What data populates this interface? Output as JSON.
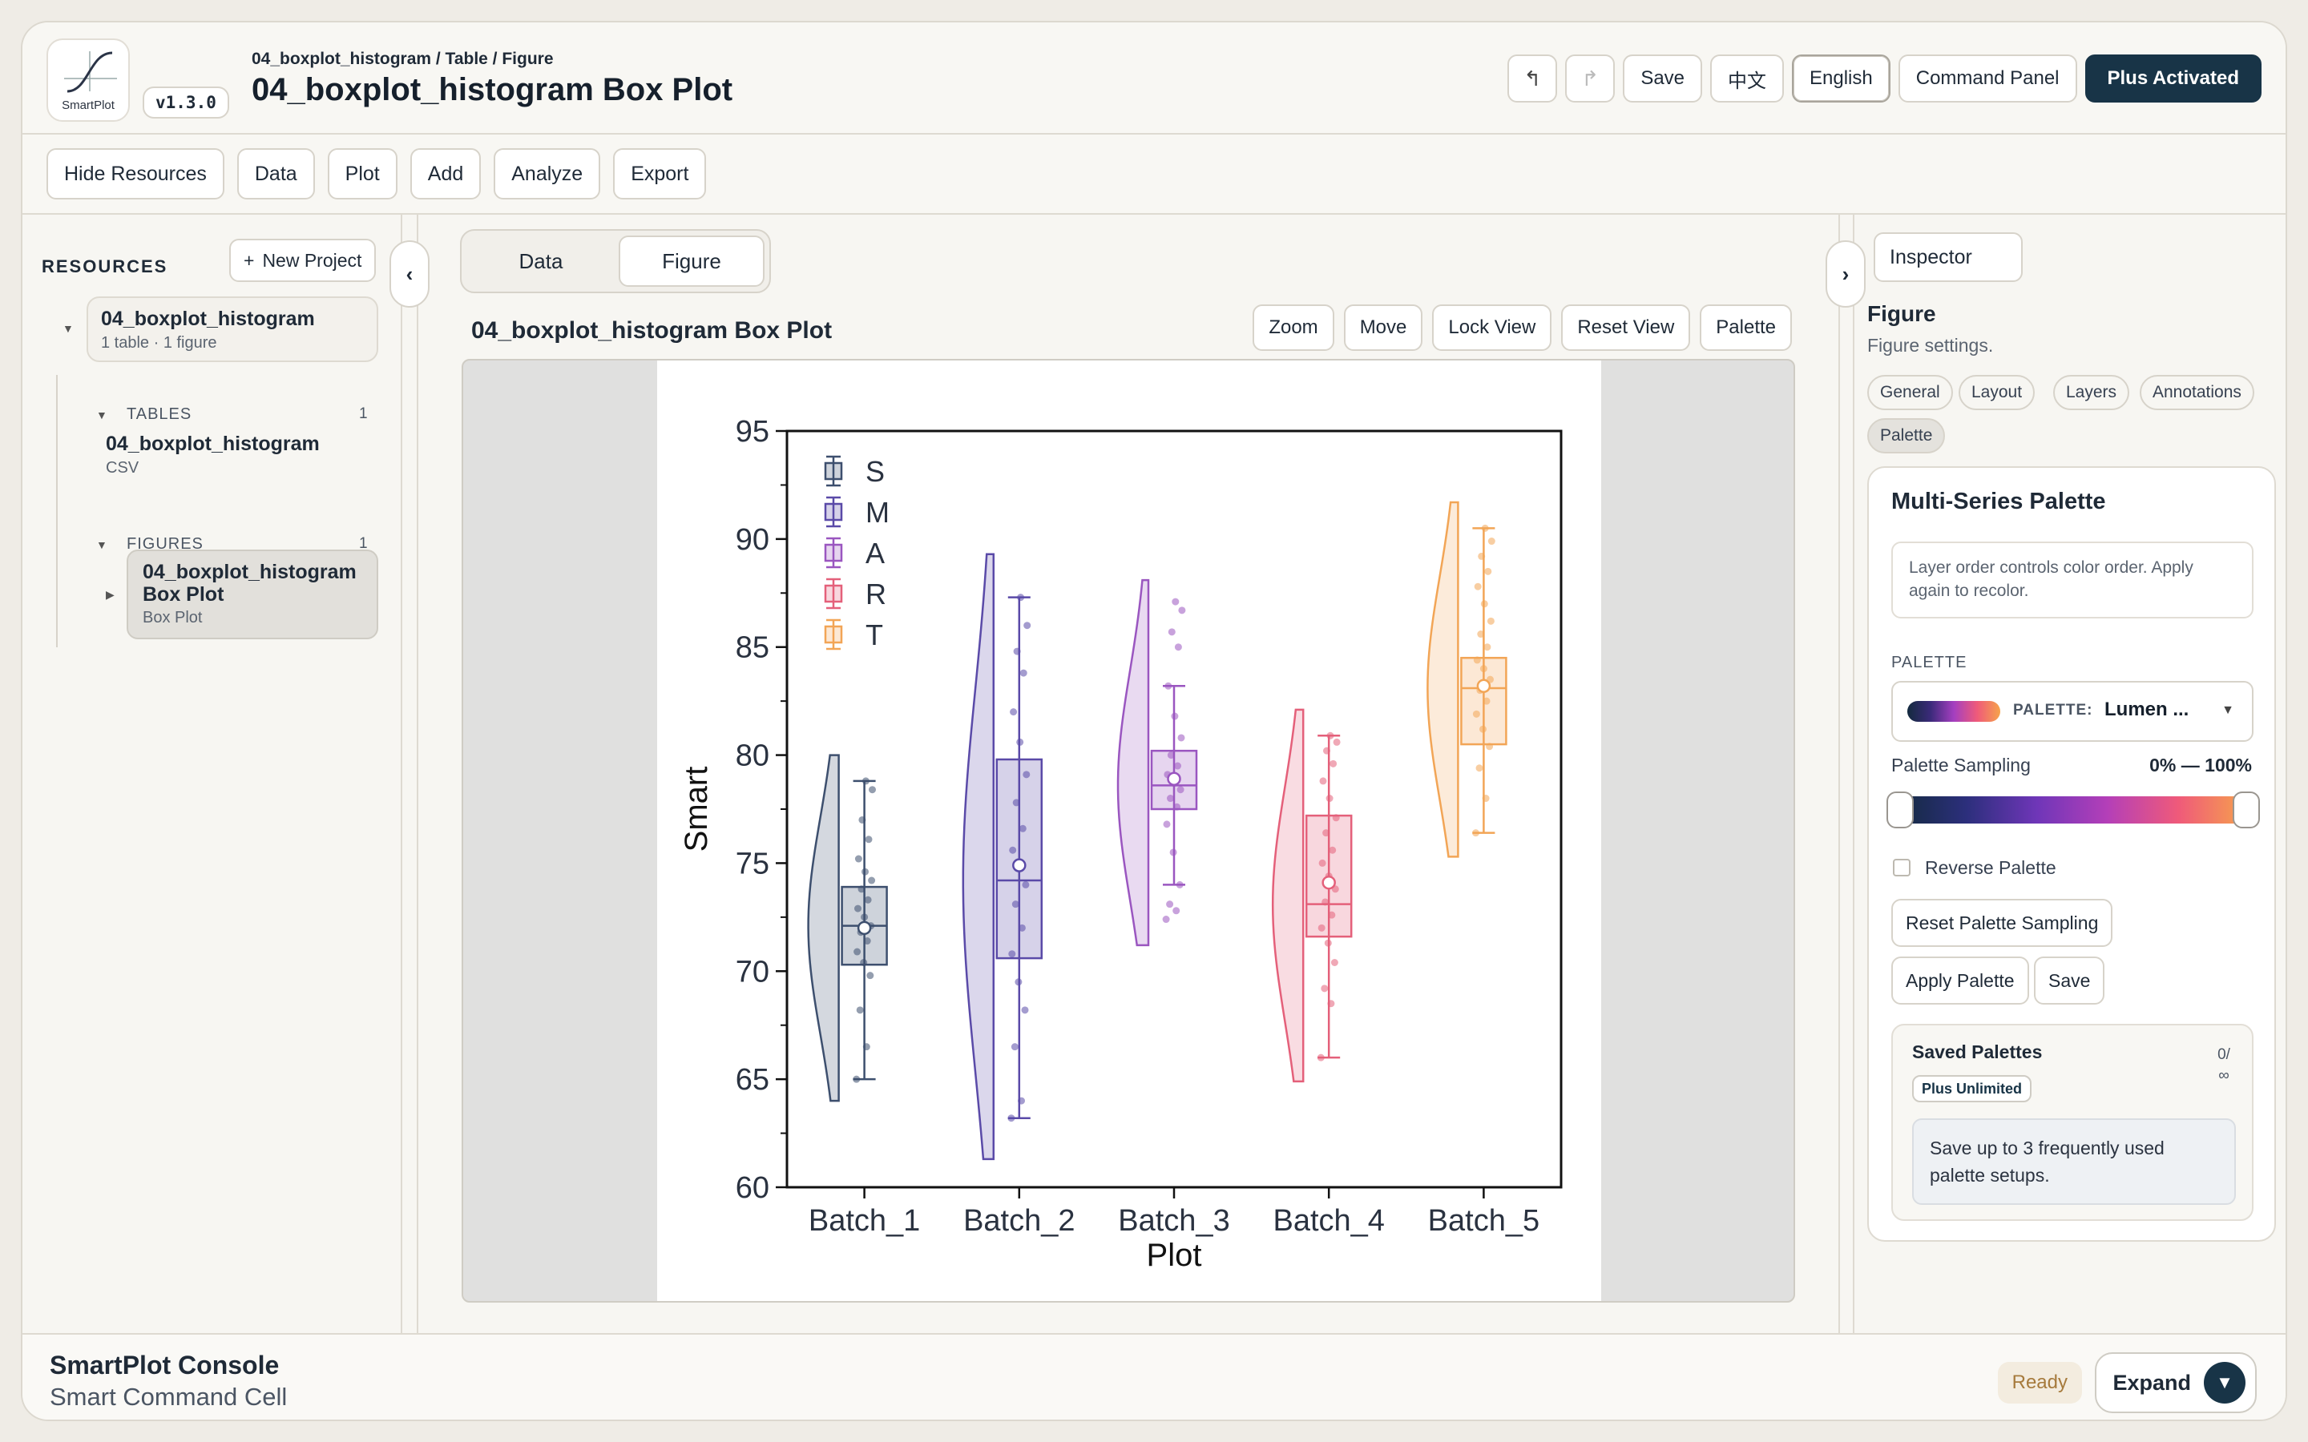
{
  "app": {
    "logo_text": "SmartPlot",
    "version": "v1.3.0",
    "breadcrumb": "04_boxplot_histogram / Table / Figure",
    "title": "04_boxplot_histogram Box Plot"
  },
  "header": {
    "undo_icon": "undo-icon",
    "redo_icon": "redo-icon",
    "save": "Save",
    "lang_zh": "中文",
    "lang_en": "English",
    "command_panel": "Command Panel",
    "plus": "Plus Activated"
  },
  "toolbar": [
    "Hide Resources",
    "Data",
    "Plot",
    "Add",
    "Analyze",
    "Export"
  ],
  "resources": {
    "heading": "RESOURCES",
    "new_project": "New Project",
    "project_name": "04_boxplot_histogram",
    "project_meta": "1 table · 1 figure",
    "tables_label": "TABLES",
    "tables_count": "1",
    "table_name": "04_boxplot_histogram",
    "table_type": "CSV",
    "figures_label": "FIGURES",
    "figures_count": "1",
    "figure_name": "04_boxplot_histogram Box Plot",
    "figure_type": "Box Plot"
  },
  "center": {
    "tab_data": "Data",
    "tab_figure": "Figure",
    "figure_title": "04_boxplot_histogram Box Plot",
    "buttons": [
      "Zoom",
      "Move",
      "Lock View",
      "Reset View",
      "Palette"
    ]
  },
  "inspector": {
    "button": "Inspector",
    "title": "Figure",
    "subtitle": "Figure settings.",
    "tabs": [
      "General",
      "Layout",
      "Layers",
      "Annotations",
      "Palette"
    ],
    "card_title": "Multi-Series Palette",
    "note": "Layer order controls color order. Apply again to recolor.",
    "palette_label": "PALETTE",
    "select_label": "PALETTE:",
    "select_value": "Lumen ...",
    "sampling_label": "Palette Sampling",
    "sampling_value": "0% — 100%",
    "sampling_range": [
      0,
      100
    ],
    "reverse": "Reverse Palette",
    "reset_btn": "Reset Palette Sampling",
    "apply_btn": "Apply Palette",
    "save_btn": "Save",
    "saved_title": "Saved Palettes",
    "saved_count": "0/ ∞",
    "saved_badge": "Plus Unlimited",
    "saved_desc": "Save up to 3 frequently used palette setups."
  },
  "footer": {
    "title": "SmartPlot Console",
    "subtitle": "Smart Command Cell",
    "status": "Ready",
    "expand": "Expand"
  },
  "chart_data": {
    "type": "box",
    "xlabel": "Plot",
    "ylabel": "Smart",
    "ylim": [
      60,
      95
    ],
    "yticks": [
      60,
      65,
      70,
      75,
      80,
      85,
      90,
      95
    ],
    "legend": [
      "S",
      "M",
      "A",
      "R",
      "T"
    ],
    "legend_position": "top-left",
    "categories": [
      "Batch_1",
      "Batch_2",
      "Batch_3",
      "Batch_4",
      "Batch_5"
    ],
    "colors": [
      "#3d4f6e",
      "#5a4aa8",
      "#9a56c0",
      "#e4607a",
      "#f2a556"
    ],
    "series": [
      {
        "q1": 70.3,
        "median": 72.1,
        "q3": 73.9,
        "mean": 72.0,
        "whisker_low": 65.0,
        "whisker_high": 78.8,
        "violin": [
          64,
          80
        ],
        "points": [
          65.0,
          66.5,
          68.2,
          69.8,
          70.4,
          70.9,
          71.4,
          71.8,
          72.1,
          72.5,
          72.9,
          73.3,
          73.8,
          74.2,
          74.6,
          75.2,
          76.1,
          77.0,
          78.4,
          78.8
        ]
      },
      {
        "q1": 70.6,
        "median": 74.2,
        "q3": 79.8,
        "mean": 74.9,
        "whisker_low": 63.2,
        "whisker_high": 87.3,
        "violin": [
          61.3,
          89.3
        ],
        "points": [
          63.2,
          64.0,
          66.5,
          68.2,
          69.5,
          70.8,
          72.0,
          73.1,
          74.0,
          74.8,
          75.6,
          76.6,
          77.8,
          79.1,
          80.6,
          82.0,
          83.8,
          84.8,
          86.0,
          87.3
        ]
      },
      {
        "q1": 77.5,
        "median": 78.6,
        "q3": 80.2,
        "mean": 78.9,
        "whisker_low": 74.0,
        "whisker_high": 83.2,
        "violin": [
          71.2,
          88.1
        ],
        "points": [
          72.4,
          72.8,
          73.1,
          74.0,
          75.5,
          76.8,
          77.6,
          78.0,
          78.4,
          78.7,
          79.1,
          79.5,
          80.0,
          80.8,
          81.8,
          83.2,
          85.0,
          85.7,
          86.7,
          87.1
        ]
      },
      {
        "q1": 71.6,
        "median": 73.1,
        "q3": 77.2,
        "mean": 74.1,
        "whisker_low": 66.0,
        "whisker_high": 80.9,
        "violin": [
          64.9,
          82.1
        ],
        "points": [
          66.0,
          68.5,
          69.2,
          70.4,
          71.3,
          72.0,
          72.6,
          73.2,
          73.8,
          74.4,
          75.0,
          75.6,
          76.4,
          77.1,
          78.0,
          78.8,
          79.6,
          80.2,
          80.6,
          80.9
        ]
      },
      {
        "q1": 80.5,
        "median": 83.1,
        "q3": 84.5,
        "mean": 83.2,
        "whisker_low": 76.4,
        "whisker_high": 90.5,
        "violin": [
          75.3,
          91.7
        ],
        "points": [
          76.4,
          78.0,
          79.4,
          80.4,
          81.2,
          81.9,
          82.5,
          83.0,
          83.5,
          84.0,
          84.4,
          85.0,
          85.6,
          86.2,
          87.0,
          87.8,
          88.5,
          89.2,
          89.9,
          90.5
        ]
      }
    ]
  }
}
